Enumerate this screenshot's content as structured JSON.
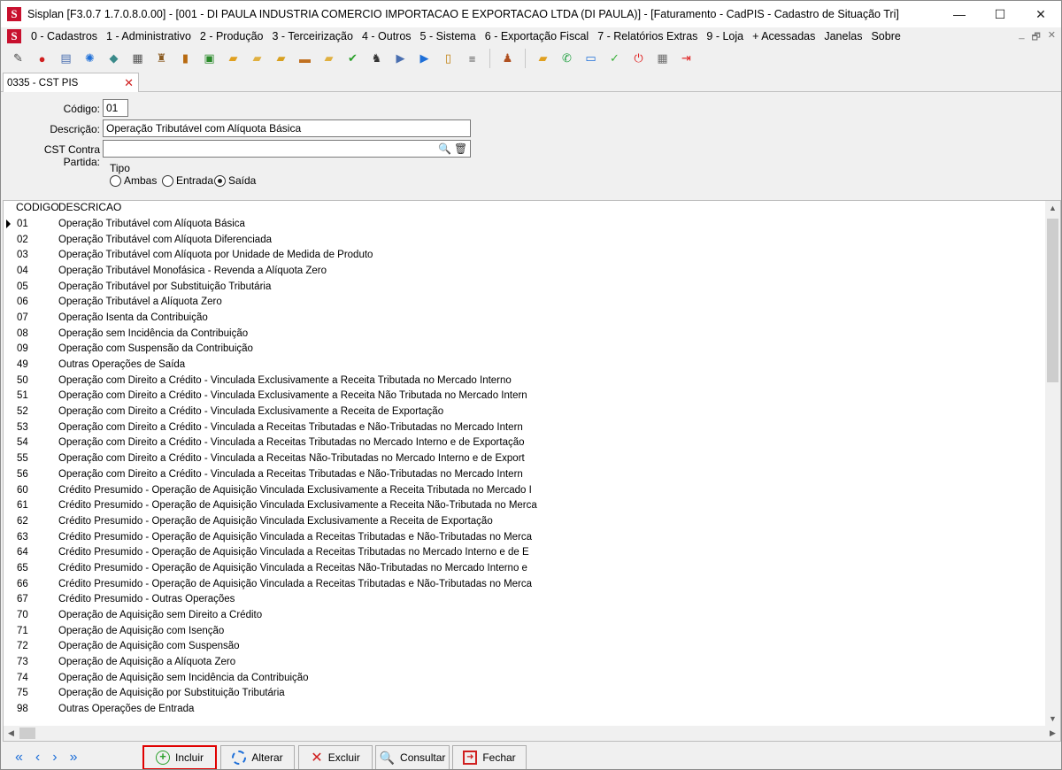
{
  "window": {
    "title": "Sisplan [F3.0.7 1.7.0.8.0.00] - [001 - DI PAULA INDUSTRIA COMERCIO IMPORTACAO E EXPORTACAO LTDA (DI PAULA)] - [Faturamento - CadPIS - Cadastro de Situação Tri]",
    "app_logo": "S",
    "minimize_icon": "—",
    "maximize_icon": "☐",
    "close_icon": "✕"
  },
  "menu": {
    "logo": "S",
    "items": [
      "0 - Cadastros",
      "1 - Administrativo",
      "2 - Produção",
      "3 - Terceirização",
      "4 - Outros",
      "5 - Sistema",
      "6 - Exportação Fiscal",
      "7 - Relatórios Extras",
      "9 - Loja",
      "+ Acessadas",
      "Janelas",
      "Sobre"
    ],
    "mdi_controls": [
      "_",
      "🗗",
      "✕"
    ]
  },
  "toolbar": {
    "icons": [
      {
        "name": "calculator-icon",
        "glyph": "✎",
        "color": "#444444"
      },
      {
        "name": "strawberry-icon",
        "glyph": "●",
        "color": "#d02020"
      },
      {
        "name": "document-edit-icon",
        "glyph": "▤",
        "color": "#4a6fb0"
      },
      {
        "name": "gear-icon",
        "glyph": "✺",
        "color": "#1e6fd8"
      },
      {
        "name": "tag-icon",
        "glyph": "◆",
        "color": "#3a8a8a"
      },
      {
        "name": "printer-icon",
        "glyph": "▦",
        "color": "#555555"
      },
      {
        "name": "bottles-icon",
        "glyph": "♜",
        "color": "#8a5a20"
      },
      {
        "name": "book-icon",
        "glyph": "▮",
        "color": "#b86a10"
      },
      {
        "name": "spreadsheet-icon",
        "glyph": "▣",
        "color": "#2a8a2a"
      },
      {
        "name": "folder-pencil-icon",
        "glyph": "▰",
        "color": "#e0a020"
      },
      {
        "name": "folder-open-icon",
        "glyph": "▰",
        "color": "#e0b040"
      },
      {
        "name": "folder-edit-icon",
        "glyph": "▰",
        "color": "#d8a020"
      },
      {
        "name": "truck-icon",
        "glyph": "▬",
        "color": "#c07020"
      },
      {
        "name": "folder-note-icon",
        "glyph": "▰",
        "color": "#e0b040"
      },
      {
        "name": "check-circle-icon",
        "glyph": "✔",
        "color": "#2aa02a"
      },
      {
        "name": "chess-icon",
        "glyph": "♞",
        "color": "#333333"
      },
      {
        "name": "document-arrow-icon",
        "glyph": "▶",
        "color": "#4a6fb0"
      },
      {
        "name": "document-import-icon",
        "glyph": "▶",
        "color": "#1e6fd8"
      },
      {
        "name": "battery-icon",
        "glyph": "▯",
        "color": "#c08010"
      },
      {
        "name": "list-view-icon",
        "glyph": "≡",
        "color": "#555555"
      },
      {
        "name": "users-icon",
        "glyph": "♟",
        "color": "#b05020"
      },
      {
        "name": "folder-move-icon",
        "glyph": "▰",
        "color": "#e0a020"
      },
      {
        "name": "whatsapp-icon",
        "glyph": "✆",
        "color": "#25a244"
      },
      {
        "name": "monitor-icon",
        "glyph": "▭",
        "color": "#1e6fd8"
      },
      {
        "name": "check-badge-icon",
        "glyph": "✓",
        "color": "#3ab03a"
      },
      {
        "name": "power-icon",
        "glyph": "⏻",
        "color": "#e02020"
      },
      {
        "name": "calculator-gray-icon",
        "glyph": "▦",
        "color": "#707070"
      },
      {
        "name": "exit-icon",
        "glyph": "⇥",
        "color": "#e02020"
      }
    ]
  },
  "tab": {
    "label": "0335 - CST PIS",
    "close_icon": "✕"
  },
  "form": {
    "codigo_label": "Código:",
    "codigo_value": "01",
    "descricao_label": "Descrição:",
    "descricao_value": "Operação Tributável com Alíquota Básica",
    "cst_label": "CST Contra Partida:",
    "cst_value": "",
    "search_icon": "🔍",
    "trash_icon": "🗑",
    "tipo_label": "Tipo",
    "radio_ambas": "Ambas",
    "radio_entrada": "Entrada",
    "radio_saida": "Saída",
    "selected": "Saída"
  },
  "grid": {
    "headers": [
      "CODIGO",
      "DESCRICAO"
    ],
    "selected_index": 0,
    "rows": [
      [
        "01",
        "Operação Tributável com Alíquota Básica"
      ],
      [
        "02",
        "Operação Tributável com Alíquota Diferenciada"
      ],
      [
        "03",
        "Operação Tributável com Alíquota por Unidade de Medida de Produto"
      ],
      [
        "04",
        "Operação Tributável Monofásica - Revenda a Alíquota Zero"
      ],
      [
        "05",
        "Operação Tributável por Substituição Tributária"
      ],
      [
        "06",
        "Operação Tributável a Alíquota Zero"
      ],
      [
        "07",
        "Operação Isenta da Contribuição"
      ],
      [
        "08",
        "Operação sem Incidência da Contribuição"
      ],
      [
        "09",
        "Operação com Suspensão da Contribuição"
      ],
      [
        "49",
        "Outras Operações de Saída"
      ],
      [
        "50",
        "Operação com Direito a Crédito - Vinculada Exclusivamente a Receita Tributada no Mercado Interno"
      ],
      [
        "51",
        "Operação com Direito a Crédito - Vinculada Exclusivamente a Receita Não Tributada no Mercado Intern"
      ],
      [
        "52",
        "Operação com Direito a Crédito - Vinculada Exclusivamente a Receita de Exportação"
      ],
      [
        "53",
        "Operação com Direito a Crédito - Vinculada a Receitas Tributadas e Não-Tributadas no Mercado Intern"
      ],
      [
        "54",
        "Operação com Direito a Crédito - Vinculada a Receitas Tributadas no Mercado Interno e de Exportação"
      ],
      [
        "55",
        "Operação com Direito a Crédito - Vinculada a Receitas Não-Tributadas no Mercado Interno e de Export"
      ],
      [
        "56",
        "Operação com Direito a Crédito - Vinculada a Receitas Tributadas e Não-Tributadas no Mercado Intern"
      ],
      [
        "60",
        "Crédito Presumido - Operação de Aquisição Vinculada Exclusivamente a Receita Tributada no Mercado I"
      ],
      [
        "61",
        "Crédito Presumido - Operação de Aquisição Vinculada Exclusivamente a Receita Não-Tributada no Merca"
      ],
      [
        "62",
        "Crédito Presumido - Operação de Aquisição Vinculada Exclusivamente a Receita de Exportação"
      ],
      [
        "63",
        "Crédito Presumido - Operação de Aquisição Vinculada a Receitas Tributadas e Não-Tributadas no Merca"
      ],
      [
        "64",
        "Crédito Presumido - Operação de Aquisição Vinculada a Receitas Tributadas no Mercado Interno e de E"
      ],
      [
        "65",
        "Crédito Presumido - Operação de Aquisição Vinculada a Receitas Não-Tributadas no Mercado Interno e"
      ],
      [
        "66",
        "Crédito Presumido - Operação de Aquisição Vinculada a Receitas Tributadas e Não-Tributadas no Merca"
      ],
      [
        "67",
        "Crédito Presumido - Outras Operações"
      ],
      [
        "70",
        "Operação de Aquisição sem Direito a Crédito"
      ],
      [
        "71",
        "Operação de Aquisição com Isenção"
      ],
      [
        "72",
        "Operação de Aquisição com Suspensão"
      ],
      [
        "73",
        "Operação de Aquisição a Alíquota Zero"
      ],
      [
        "74",
        "Operação de Aquisição sem Incidência da Contribuição"
      ],
      [
        "75",
        "Operação de Aquisição por Substituição Tributária"
      ],
      [
        "98",
        "Outras Operações de Entrada"
      ]
    ],
    "scroll_up_icon": "▲",
    "scroll_down_icon": "▼",
    "scroll_left_icon": "◀",
    "scroll_right_icon": "▶"
  },
  "nav": {
    "first_icon": "«",
    "prev_icon": "‹",
    "next_icon": "›",
    "last_icon": "»"
  },
  "actions": {
    "incluir": "Incluir",
    "alterar": "Alterar",
    "excluir": "Excluir",
    "consultar": "Consultar",
    "fechar": "Fechar"
  }
}
